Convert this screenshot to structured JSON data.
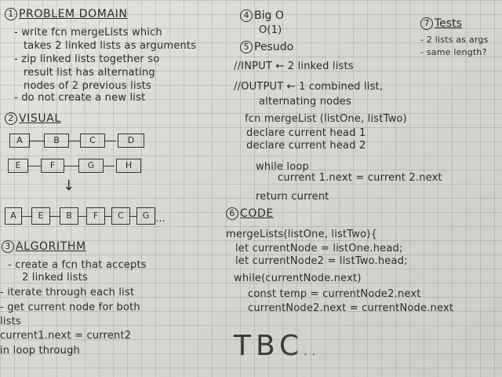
{
  "s1": {
    "num": "1",
    "title": "PROBLEM DOMAIN",
    "lines": [
      "- write fcn mergeLists which",
      "takes 2 linked lists as arguments",
      "- zip linked lists together so",
      "result list has alternating",
      "nodes of 2 previous lists",
      "- do not create a new list"
    ]
  },
  "s2": {
    "num": "2",
    "title": "VISUAL",
    "row1": [
      "A",
      "B",
      "C",
      "D"
    ],
    "row2": [
      "E",
      "F",
      "G",
      "H"
    ],
    "arrow": "↓",
    "row3": [
      "A",
      "E",
      "B",
      "F",
      "C",
      "G"
    ],
    "ellipsis": "..."
  },
  "s3": {
    "num": "3",
    "title": "ALGORITHM",
    "lines": [
      "- create a fcn that accepts",
      "2 linked lists",
      "- iterate through each list",
      "- get current node for both",
      "lists",
      "current1.next = current2",
      "in loop through"
    ]
  },
  "s4": {
    "num": "4",
    "title": "Big O",
    "value": "O(1)"
  },
  "s5": {
    "num": "5",
    "title": "Pesudo",
    "input": "//INPUT ← 2 linked lists",
    "output1": "//OUTPUT ← 1 combined list,",
    "output2": "alternating nodes",
    "lines": [
      "fcn mergeList (listOne, listTwo)",
      "declare current head 1",
      "declare current head 2",
      "while loop",
      "current 1.next = current 2.next",
      "return current"
    ]
  },
  "s6": {
    "num": "6",
    "title": "CODE",
    "lines": [
      "mergeLists(listOne, listTwo){",
      "let currentNode = listOne.head;",
      "let currentNode2 = listTwo.head;",
      "while(currentNode.next)",
      "const temp = currentNode2.next",
      "currentNode2.next = currentNode.next"
    ],
    "tbc": "TBC",
    "tbc_dots": ".."
  },
  "s7": {
    "num": "7",
    "title": "Tests",
    "lines": [
      "- 2 lists as args",
      "- same length?"
    ]
  }
}
